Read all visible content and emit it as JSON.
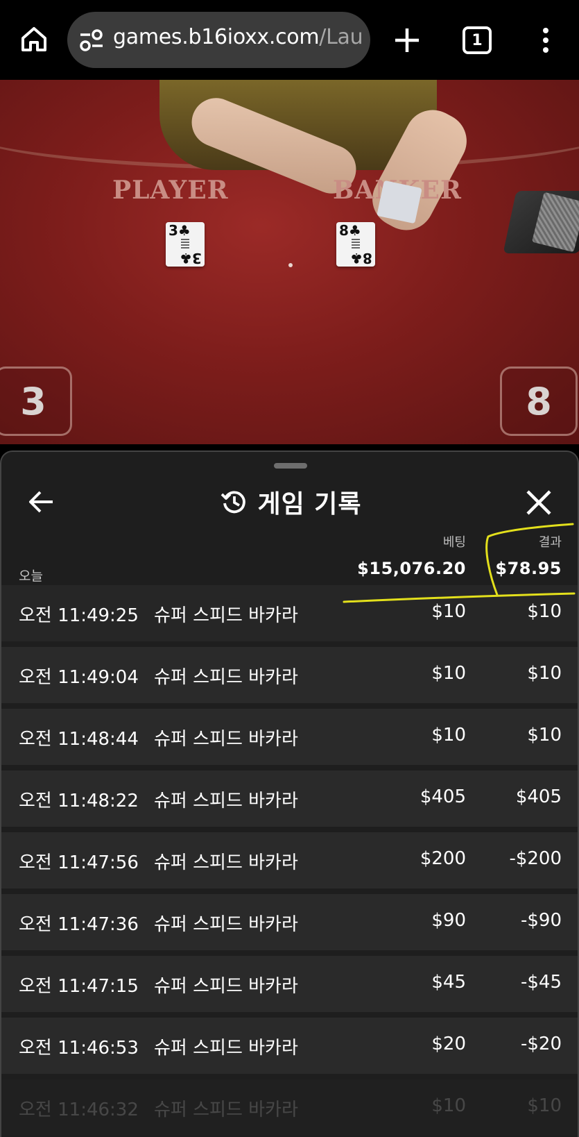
{
  "browser": {
    "url_host": "games.b16ioxx.com",
    "url_path": "/Lau",
    "tab_count": "1",
    "icons": [
      "home-icon",
      "site-settings-icon",
      "plus-icon",
      "tabs-icon",
      "more-vert-icon"
    ]
  },
  "video": {
    "player_label": "PLAYER",
    "banker_label": "BANKER",
    "player_card": {
      "rank": "3",
      "suit": "♣"
    },
    "banker_card": {
      "rank": "8",
      "suit": "♣"
    },
    "player_score": "3",
    "banker_score": "8"
  },
  "panel": {
    "title": "게임 기록",
    "icons": [
      "back-arrow-icon",
      "history-icon",
      "close-icon"
    ],
    "summary": {
      "period": "오늘",
      "bet_label": "베팅",
      "bet_total": "$15,076.20",
      "result_label": "결과",
      "result_total": "$78.95"
    },
    "rows": [
      {
        "time": "오전 11:49:25",
        "game": "슈퍼 스피드 바카라",
        "bet": "$10",
        "result": "$10"
      },
      {
        "time": "오전 11:49:04",
        "game": "슈퍼 스피드 바카라",
        "bet": "$10",
        "result": "$10"
      },
      {
        "time": "오전 11:48:44",
        "game": "슈퍼 스피드 바카라",
        "bet": "$10",
        "result": "$10"
      },
      {
        "time": "오전 11:48:22",
        "game": "슈퍼 스피드 바카라",
        "bet": "$405",
        "result": "$405"
      },
      {
        "time": "오전 11:47:56",
        "game": "슈퍼 스피드 바카라",
        "bet": "$200",
        "result": "-$200"
      },
      {
        "time": "오전 11:47:36",
        "game": "슈퍼 스피드 바카라",
        "bet": "$90",
        "result": "-$90"
      },
      {
        "time": "오전 11:47:15",
        "game": "슈퍼 스피드 바카라",
        "bet": "$45",
        "result": "-$45"
      },
      {
        "time": "오전 11:46:53",
        "game": "슈퍼 스피드 바카라",
        "bet": "$20",
        "result": "-$20"
      },
      {
        "time": "오전 11:46:32",
        "game": "슈퍼 스피드 바카라",
        "bet": "$10",
        "result": "$10"
      }
    ],
    "highlight_color": "#e3e01c"
  }
}
